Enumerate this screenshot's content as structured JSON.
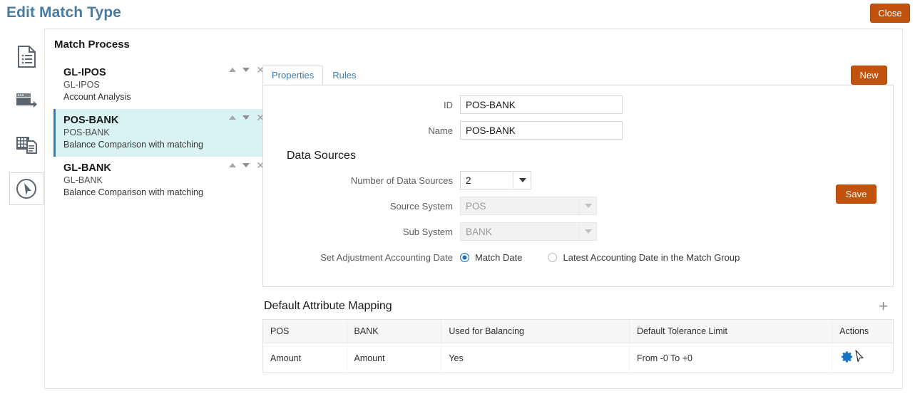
{
  "header": {
    "title": "Edit Match Type",
    "close_label": "Close",
    "title_color": "#4a7ba0",
    "button_color": "#c1530d"
  },
  "rail": {
    "items": [
      {
        "name": "document-list-icon",
        "selected": false
      },
      {
        "name": "card-export-icon",
        "selected": false
      },
      {
        "name": "grid-report-icon",
        "selected": false
      },
      {
        "name": "cursor-circle-icon",
        "selected": true
      }
    ]
  },
  "main": {
    "section_title": "Match Process",
    "new_label": "New"
  },
  "process_list": {
    "items": [
      {
        "name": "GL-IPOS",
        "sub": "GL-IPOS",
        "desc": "Account Analysis",
        "selected": false
      },
      {
        "name": "POS-BANK",
        "sub": "POS-BANK",
        "desc": "Balance Comparison with matching",
        "selected": true
      },
      {
        "name": "GL-BANK",
        "sub": "GL-BANK",
        "desc": "Balance Comparison with matching",
        "selected": false
      }
    ],
    "row_actions": {
      "move_up": "▲",
      "move_down": "▼",
      "remove": "✕"
    }
  },
  "tabs": [
    {
      "label": "Properties",
      "active": true
    },
    {
      "label": "Rules",
      "active": false
    }
  ],
  "properties": {
    "save_label": "Save",
    "id_label": "ID",
    "id_value": "POS-BANK",
    "name_label": "Name",
    "name_value": "POS-BANK",
    "data_sources_heading": "Data Sources",
    "number_label": "Number of Data Sources",
    "number_value": "2",
    "source_system_label": "Source System",
    "source_system_value": "POS",
    "sub_system_label": "Sub System",
    "sub_system_value": "BANK",
    "adjustment_label": "Set Adjustment Accounting Date",
    "radio_options": [
      {
        "label": "Match Date",
        "selected": true
      },
      {
        "label": "Latest Accounting Date in the Match Group",
        "selected": false
      }
    ]
  },
  "attribute_mapping": {
    "title": "Default Attribute Mapping",
    "add_label": "+",
    "columns": [
      "POS",
      "BANK",
      "Used for Balancing",
      "Default Tolerance Limit",
      "Actions"
    ],
    "rows": [
      {
        "pos": "Amount",
        "bank": "Amount",
        "used_for_balancing": "Yes",
        "tolerance": "From -0 To +0",
        "action_icon": "gear-icon"
      }
    ],
    "gear_color": "#1a72c4"
  }
}
